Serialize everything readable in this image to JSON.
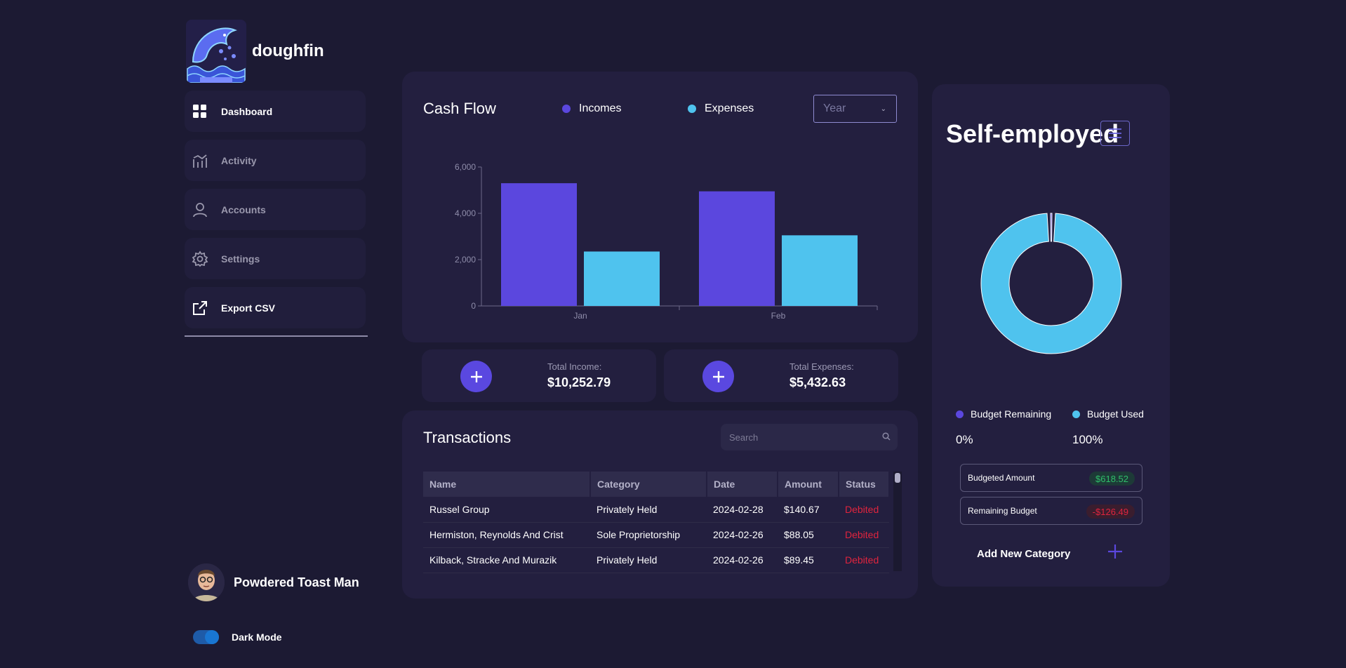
{
  "brand": {
    "name": "doughfin"
  },
  "sidebar": {
    "items": [
      {
        "label": "Dashboard",
        "icon": "dashboard-icon"
      },
      {
        "label": "Activity",
        "icon": "activity-icon"
      },
      {
        "label": "Accounts",
        "icon": "user-icon"
      },
      {
        "label": "Settings",
        "icon": "gear-icon"
      },
      {
        "label": "Export CSV",
        "icon": "export-icon"
      }
    ]
  },
  "profile": {
    "name": "Powdered Toast Man"
  },
  "dark_mode": {
    "label": "Dark Mode",
    "on": true
  },
  "cashflow": {
    "title": "Cash Flow",
    "legend": [
      {
        "label": "Incomes",
        "color": "#5b47de"
      },
      {
        "label": "Expenses",
        "color": "#4fc3ee"
      }
    ],
    "period_select": "Year"
  },
  "chart_data": {
    "type": "bar",
    "categories": [
      "Jan",
      "Feb"
    ],
    "series": [
      {
        "name": "Incomes",
        "values": [
          5300,
          4950
        ]
      },
      {
        "name": "Expenses",
        "values": [
          2350,
          3050
        ]
      }
    ],
    "yticks": [
      "0",
      "2,000",
      "4,000",
      "6,000"
    ],
    "ylim": [
      0,
      6000
    ],
    "colors": [
      "#5b47de",
      "#4fc3ee"
    ]
  },
  "stats": {
    "income": {
      "label": "Total Income:",
      "value": "$10,252.79"
    },
    "expenses": {
      "label": "Total Expenses:",
      "value": "$5,432.63"
    }
  },
  "transactions": {
    "title": "Transactions",
    "search_placeholder": "Search",
    "columns": [
      "Name",
      "Category",
      "Date",
      "Amount",
      "Status"
    ],
    "rows": [
      [
        "Russel Group",
        "Privately Held",
        "2024-02-28",
        "$140.67",
        "Debited"
      ],
      [
        "Hermiston, Reynolds And Crist",
        "Sole Proprietorship",
        "2024-02-26",
        "$88.05",
        "Debited"
      ],
      [
        "Kilback, Stracke And Murazik",
        "Privately Held",
        "2024-02-26",
        "$89.45",
        "Debited"
      ]
    ]
  },
  "budget": {
    "title": "Self-employed",
    "donut": {
      "remaining_fraction": 0,
      "used_fraction": 1,
      "remaining_color": "#5b47de",
      "used_color": "#4fc3ee"
    },
    "legend": [
      {
        "label": "Budget Remaining",
        "value": "0%",
        "color": "#5b47de"
      },
      {
        "label": "Budget Used",
        "value": "100%",
        "color": "#4fc3ee"
      }
    ],
    "budgeted_amount": {
      "label": "Budgeted Amount",
      "value": "$618.52"
    },
    "remaining_budget": {
      "label": "Remaining Budget",
      "value": "-$126.49"
    },
    "add_category_label": "Add New Category"
  }
}
